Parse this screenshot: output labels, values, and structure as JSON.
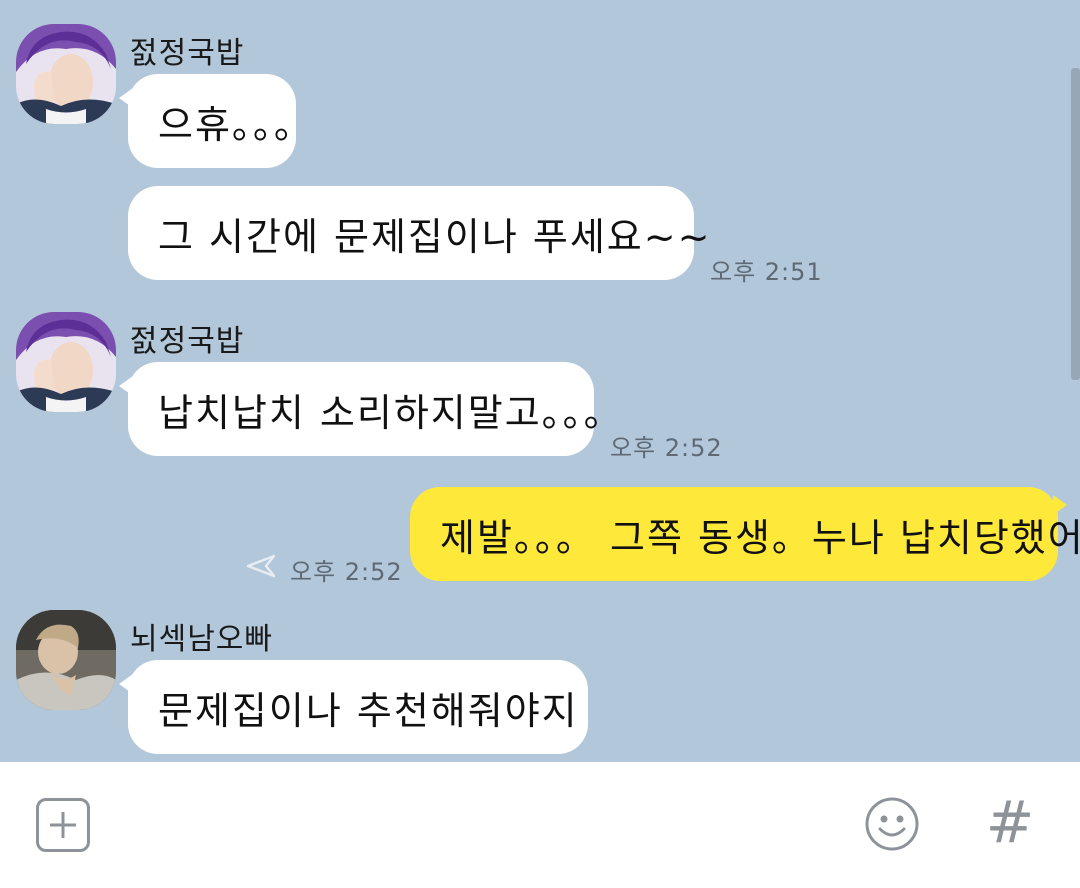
{
  "messages": [
    {
      "sender": "젌정국밥",
      "bubbles": [
        "으휴。。。",
        "그 시간에 문제집이나 푸세요~~"
      ],
      "time": "오후 2:51"
    },
    {
      "sender": "젌정국밥",
      "bubbles": [
        "납치납치 소리하지말고。。。"
      ],
      "time": "오후 2:52"
    },
    {
      "sender": "me",
      "bubbles": [
        "제발。。。 그쪽 동생。누나 납치당했어요"
      ],
      "time": "오후 2:52"
    },
    {
      "sender": "뇌섹남오빠",
      "bubbles": [
        "문제집이나 추천해줘야지"
      ]
    }
  ],
  "colors": {
    "background": "#b2c7da",
    "my_bubble": "#fee93b",
    "other_bubble": "#ffffff"
  },
  "input_bar": {
    "icons": [
      "plus-icon",
      "emoji-icon",
      "hashtag-icon"
    ]
  }
}
